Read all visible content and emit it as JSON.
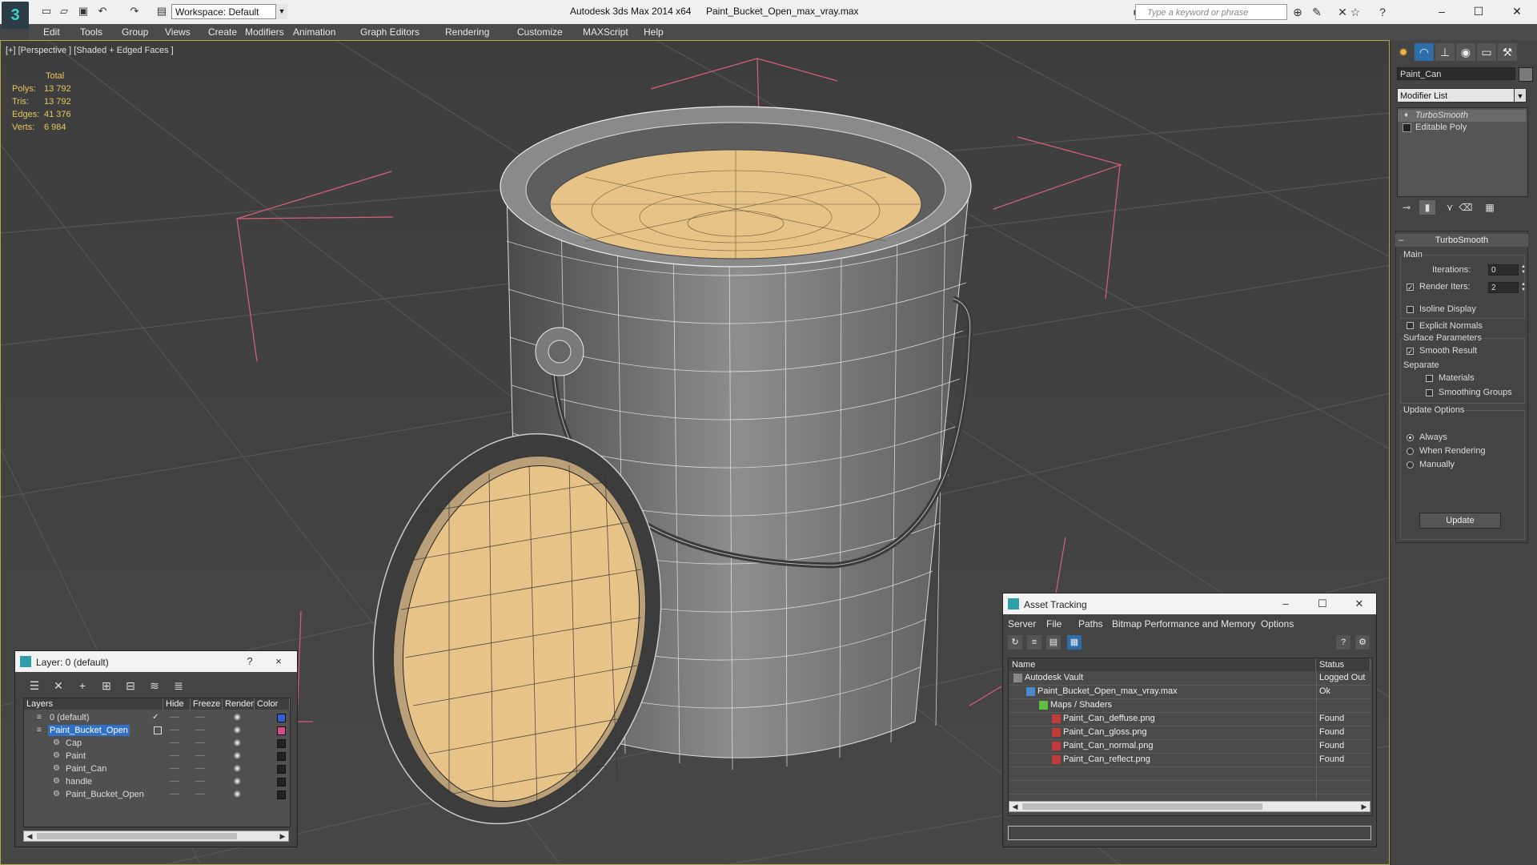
{
  "window": {
    "app_title": "Autodesk 3ds Max 2014 x64",
    "document_title": "Paint_Bucket_Open_max_vray.max",
    "workspace": "Workspace: Default",
    "search_placeholder": "Type a keyword or phrase"
  },
  "menu": [
    "Edit",
    "Tools",
    "Group",
    "Views",
    "Create",
    "Modifiers",
    "Animation",
    "Graph Editors",
    "Rendering",
    "Customize",
    "MAXScript",
    "Help"
  ],
  "viewport": {
    "label": "[+] [Perspective ] [Shaded + Edged Faces ]",
    "stats": {
      "header": "Total",
      "rows": [
        {
          "label": "Polys:",
          "value": "13 792"
        },
        {
          "label": "Tris:",
          "value": "13 792"
        },
        {
          "label": "Edges:",
          "value": "41 376"
        },
        {
          "label": "Verts:",
          "value": "6 984"
        }
      ]
    }
  },
  "command_panel": {
    "object_name": "Paint_Can",
    "modifier_list": "Modifier List",
    "stack": [
      {
        "label": "TurboSmooth",
        "italic": true
      },
      {
        "label": "Editable Poly",
        "italic": false
      }
    ],
    "rollout_title": "TurboSmooth",
    "main_group": "Main",
    "iterations_label": "Iterations:",
    "iterations_value": "0",
    "render_iters_label": "Render Iters:",
    "render_iters_value": "2",
    "render_iters_checked": true,
    "isoline_label": "Isoline Display",
    "isoline_checked": false,
    "explicit_normals_label": "Explicit Normals",
    "explicit_normals_checked": false,
    "surface_group": "Surface Parameters",
    "smooth_result_label": "Smooth Result",
    "smooth_result_checked": true,
    "separate_label": "Separate",
    "materials_label": "Materials",
    "materials_checked": false,
    "smoothing_groups_label": "Smoothing Groups",
    "smoothing_groups_checked": false,
    "update_group": "Update Options",
    "update_options": [
      {
        "label": "Always",
        "selected": true
      },
      {
        "label": "When Rendering",
        "selected": false
      },
      {
        "label": "Manually",
        "selected": false
      }
    ],
    "update_button": "Update"
  },
  "layer_dialog": {
    "title": "Layer: 0 (default)",
    "help": "?",
    "close": "×",
    "columns": {
      "layers": "Layers",
      "hide": "Hide",
      "freeze": "Freeze",
      "render": "Render",
      "color": "Color"
    },
    "rows": [
      {
        "name": "0 (default)",
        "indent": 0,
        "selected": false,
        "active": true,
        "color": "#2f5fd0"
      },
      {
        "name": "Paint_Bucket_Open",
        "indent": 0,
        "selected": true,
        "active": false,
        "color": "#d64c8a"
      },
      {
        "name": "Cap",
        "indent": 1,
        "selected": false,
        "active": false,
        "color": "#222222"
      },
      {
        "name": "Paint",
        "indent": 1,
        "selected": false,
        "active": false,
        "color": "#222222"
      },
      {
        "name": "Paint_Can",
        "indent": 1,
        "selected": false,
        "active": false,
        "color": "#222222"
      },
      {
        "name": "handle",
        "indent": 1,
        "selected": false,
        "active": false,
        "color": "#222222"
      },
      {
        "name": "Paint_Bucket_Open",
        "indent": 1,
        "selected": false,
        "active": false,
        "color": "#222222"
      }
    ]
  },
  "asset_dialog": {
    "title": "Asset Tracking",
    "menu": [
      "Server",
      "File",
      "Paths",
      "Bitmap Performance and Memory",
      "Options"
    ],
    "columns": {
      "name": "Name",
      "status": "Status"
    },
    "rows": [
      {
        "name": "Autodesk Vault",
        "status": "Logged Out",
        "indent": 0,
        "icon": "vault-icon"
      },
      {
        "name": "Paint_Bucket_Open_max_vray.max",
        "status": "Ok",
        "indent": 1,
        "icon": "max-file-icon"
      },
      {
        "name": "Maps / Shaders",
        "status": "",
        "indent": 2,
        "icon": "maps-folder-icon"
      },
      {
        "name": "Paint_Can_deffuse.png",
        "status": "Found",
        "indent": 3,
        "icon": "png-file-icon"
      },
      {
        "name": "Paint_Can_gloss.png",
        "status": "Found",
        "indent": 3,
        "icon": "png-file-icon"
      },
      {
        "name": "Paint_Can_normal.png",
        "status": "Found",
        "indent": 3,
        "icon": "png-file-icon"
      },
      {
        "name": "Paint_Can_reflect.png",
        "status": "Found",
        "indent": 3,
        "icon": "png-file-icon"
      }
    ]
  }
}
